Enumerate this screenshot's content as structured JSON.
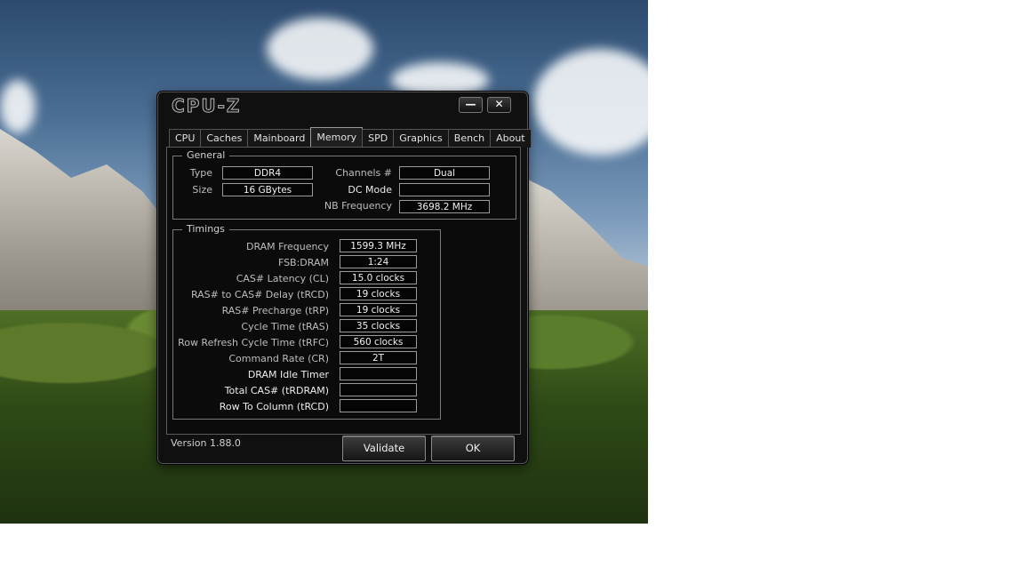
{
  "window": {
    "title": "CPU-Z",
    "minimize_glyph": "—",
    "close_glyph": "✕"
  },
  "tabs": [
    {
      "label": "CPU"
    },
    {
      "label": "Caches"
    },
    {
      "label": "Mainboard"
    },
    {
      "label": "Memory",
      "active": true
    },
    {
      "label": "SPD"
    },
    {
      "label": "Graphics"
    },
    {
      "label": "Bench"
    },
    {
      "label": "About"
    }
  ],
  "general": {
    "title": "General",
    "type_label": "Type",
    "type_value": "DDR4",
    "size_label": "Size",
    "size_value": "16 GBytes",
    "channels_label": "Channels #",
    "channels_value": "Dual",
    "dc_mode_label": "DC Mode",
    "dc_mode_value": "",
    "nb_freq_label": "NB Frequency",
    "nb_freq_value": "3698.2 MHz"
  },
  "timings": {
    "title": "Timings",
    "rows": [
      {
        "label": "DRAM Frequency",
        "value": "1599.3 MHz"
      },
      {
        "label": "FSB:DRAM",
        "value": "1:24"
      },
      {
        "label": "CAS# Latency (CL)",
        "value": "15.0 clocks"
      },
      {
        "label": "RAS# to CAS# Delay (tRCD)",
        "value": "19 clocks"
      },
      {
        "label": "RAS# Precharge (tRP)",
        "value": "19 clocks"
      },
      {
        "label": "Cycle Time (tRAS)",
        "value": "35 clocks"
      },
      {
        "label": "Row Refresh Cycle Time (tRFC)",
        "value": "560 clocks"
      },
      {
        "label": "Command Rate (CR)",
        "value": "2T"
      },
      {
        "label": "DRAM Idle Timer",
        "value": ""
      },
      {
        "label": "Total CAS# (tRDRAM)",
        "value": ""
      },
      {
        "label": "Row To Column (tRCD)",
        "value": ""
      }
    ]
  },
  "footer": {
    "version": "Version 1.88.0",
    "validate_label": "Validate",
    "ok_label": "OK"
  }
}
